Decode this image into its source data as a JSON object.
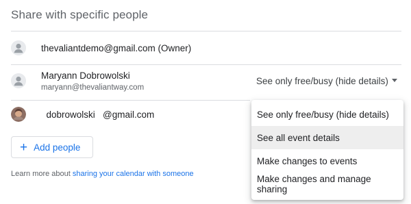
{
  "section": {
    "title": "Share with specific people"
  },
  "people": [
    {
      "name": "thevaliantdemo@gmail.com (Owner)",
      "email": "",
      "avatar": "person-icon"
    },
    {
      "name": "Maryann Dobrowolski",
      "email": "maryann@thevaliantway.com",
      "avatar": "person-icon",
      "permission": "See only free/busy (hide details)"
    },
    {
      "name": "  dobrowolski   @gmail.com",
      "email": "",
      "avatar": "photo"
    }
  ],
  "add_people": {
    "label": "Add people",
    "icon": "plus-icon"
  },
  "learn_more": {
    "prefix": "Learn more about ",
    "link": "sharing your calendar with someone"
  },
  "dropdown": {
    "options": [
      "See only free/busy (hide details)",
      "See all event details",
      "Make changes to events",
      "Make changes and manage sharing"
    ],
    "highlighted_index": 1
  },
  "colors": {
    "accent": "#1a73e8",
    "divider": "#dadce0",
    "highlight": "#eeeeee"
  }
}
